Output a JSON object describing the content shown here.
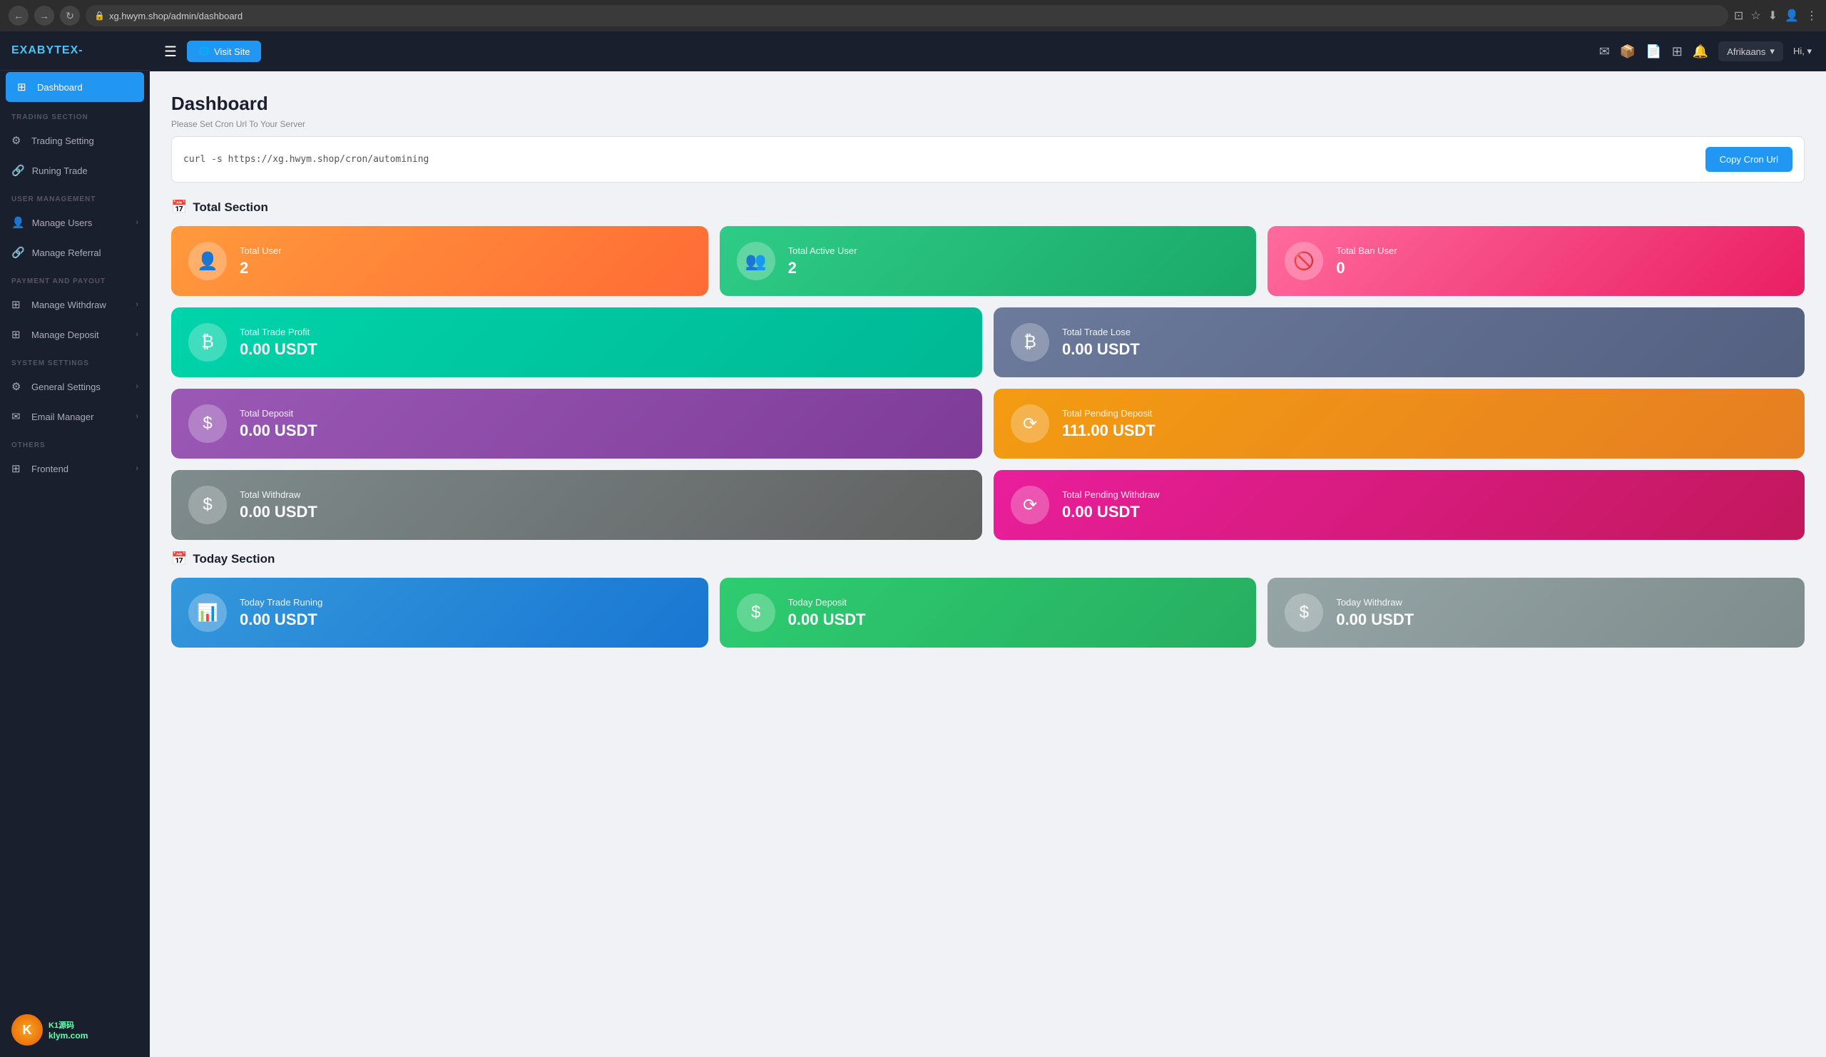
{
  "browser": {
    "url": "xg.hwym.shop/admin/dashboard",
    "nav": [
      "←",
      "→",
      "↻"
    ]
  },
  "topbar": {
    "menu_icon": "☰",
    "visit_site_label": "Visit Site",
    "globe_icon": "🌐",
    "language": "Afrikaans",
    "hi_label": "Hi,",
    "icons": [
      "✉",
      "📦",
      "📄",
      "⊞",
      "🔔"
    ]
  },
  "sidebar": {
    "brand": "EXABYTEX-",
    "active_item": "Dashboard",
    "sections": [
      {
        "label": "",
        "items": [
          {
            "icon": "⊞",
            "label": "Dashboard",
            "active": true,
            "arrow": false
          }
        ]
      },
      {
        "label": "TRADING SECTION",
        "items": [
          {
            "icon": "⚙",
            "label": "Trading Setting",
            "active": false,
            "arrow": false
          },
          {
            "icon": "🔗",
            "label": "Runing Trade",
            "active": false,
            "arrow": false
          }
        ]
      },
      {
        "label": "USER MANAGEMENT",
        "items": [
          {
            "icon": "👤",
            "label": "Manage Users",
            "active": false,
            "arrow": true
          },
          {
            "icon": "🔗",
            "label": "Manage Referral",
            "active": false,
            "arrow": false
          }
        ]
      },
      {
        "label": "PAYMENT AND PAYOUT",
        "items": [
          {
            "icon": "⊞",
            "label": "Manage Withdraw",
            "active": false,
            "arrow": true
          },
          {
            "icon": "⊞",
            "label": "Manage Deposit",
            "active": false,
            "arrow": true
          }
        ]
      },
      {
        "label": "SYSTEM SETTINGS",
        "items": [
          {
            "icon": "⚙",
            "label": "General Settings",
            "active": false,
            "arrow": true
          },
          {
            "icon": "✉",
            "label": "Email Manager",
            "active": false,
            "arrow": true
          }
        ]
      },
      {
        "label": "OTHERS",
        "items": [
          {
            "icon": "⊞",
            "label": "Frontend",
            "active": false,
            "arrow": true
          }
        ]
      }
    ],
    "logo_text": "klym.com"
  },
  "page": {
    "title": "Dashboard",
    "cron_note": "Please Set Cron Url To Your Server",
    "cron_url": "curl -s https://xg.hwym.shop/cron/automining",
    "copy_btn": "Copy Cron Url",
    "total_section_label": "Total Section",
    "today_section_label": "Today Section"
  },
  "total_stats": [
    {
      "label": "Total User",
      "value": "2",
      "icon": "👤",
      "color": "card-orange"
    },
    {
      "label": "Total Active User",
      "value": "2",
      "icon": "👥",
      "color": "card-green"
    },
    {
      "label": "Total Ban User",
      "value": "0",
      "icon": "🚫",
      "color": "card-pink"
    },
    {
      "label": "Total Trade Profit",
      "value": "0.00 USDT",
      "icon": "₿",
      "color": "card-teal"
    },
    {
      "label": "Total Trade Lose",
      "value": "0.00 USDT",
      "icon": "₿",
      "color": "card-slate"
    },
    {
      "label": "Total Deposit",
      "value": "0.00 USDT",
      "icon": "$",
      "color": "card-purple"
    },
    {
      "label": "Total Pending Deposit",
      "value": "111.00 USDT",
      "icon": "⟳",
      "color": "card-orange2"
    },
    {
      "label": "Total Withdraw",
      "value": "0.00 USDT",
      "icon": "$",
      "color": "card-darkgray"
    },
    {
      "label": "Total Pending Withdraw",
      "value": "0.00 USDT",
      "icon": "⟳",
      "color": "card-magenta"
    }
  ],
  "today_stats": [
    {
      "label": "Today Trade Runing",
      "value": "0.00 USDT",
      "icon": "📊",
      "color": "card-blue"
    },
    {
      "label": "Today Deposit",
      "value": "0.00 USDT",
      "icon": "$",
      "color": "card-emerald"
    },
    {
      "label": "Today Withdraw",
      "value": "0.00 USDT",
      "icon": "$",
      "color": "card-gray2"
    }
  ]
}
